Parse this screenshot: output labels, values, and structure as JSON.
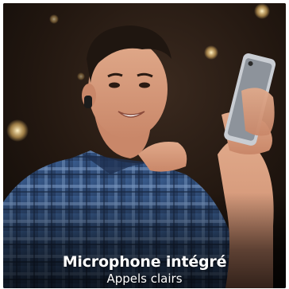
{
  "banner": {
    "headline": "Microphone intégré",
    "subheadline": "Appels clairs"
  },
  "photo": {
    "subject": "man-using-wireless-earbud-and-smartphone-icon"
  },
  "colors": {
    "caption_text": "#ffffff",
    "shirt_blue": "#2f4f7f",
    "background_dark": "#1a1410"
  }
}
